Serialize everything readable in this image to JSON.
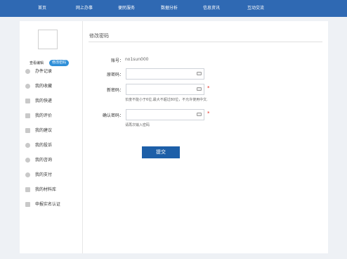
{
  "topnav": {
    "items": [
      {
        "label": "首页"
      },
      {
        "label": "网上办事"
      },
      {
        "label": "便民服务"
      },
      {
        "label": "数据分析"
      },
      {
        "label": "信息资讯"
      },
      {
        "label": "互动交流"
      }
    ]
  },
  "profile": {
    "view_label": "查看编辑",
    "change_password_label": "修改密码"
  },
  "sidebar": {
    "items": [
      {
        "label": "办件记录",
        "icon": "record-icon"
      },
      {
        "label": "我的收藏",
        "icon": "star-icon"
      },
      {
        "label": "我的快递",
        "icon": "express-icon"
      },
      {
        "label": "我的评价",
        "icon": "rating-icon"
      },
      {
        "label": "我的建议",
        "icon": "suggestion-icon"
      },
      {
        "label": "我的投诉",
        "icon": "complaint-icon"
      },
      {
        "label": "我的咨询",
        "icon": "consult-icon"
      },
      {
        "label": "我的支付",
        "icon": "payment-icon"
      },
      {
        "label": "我的材料库",
        "icon": "library-icon"
      },
      {
        "label": "申报实名认证",
        "icon": "id-card-icon"
      }
    ]
  },
  "form": {
    "title": "修改密码",
    "account_label": "账号：",
    "account_value": "no1sun000",
    "old_password_label": "原密码：",
    "new_password_label": "新密码：",
    "confirm_password_label": "确认密码：",
    "required_mark": "*",
    "new_password_hint": "长度不能小于6位,最大不超过80位，不允许使用中文.",
    "confirm_password_hint": "请再次输入密码",
    "submit_label": "提交"
  },
  "colors": {
    "nav_background": "#2f69b3",
    "submit_button": "#1d5fa8",
    "badge": "#2f8fd8",
    "required": "#e2231a"
  }
}
